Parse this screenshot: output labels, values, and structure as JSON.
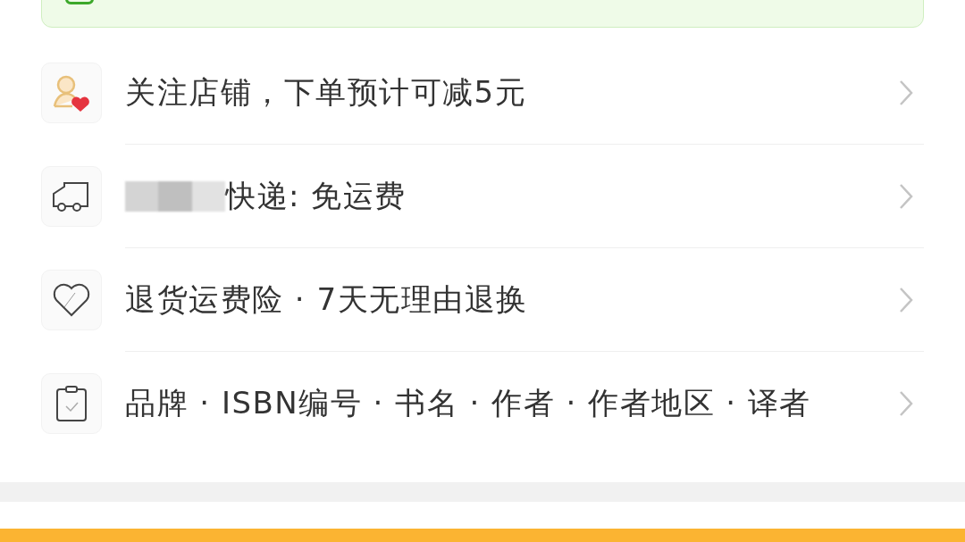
{
  "banner": {
    "kind": "notice"
  },
  "service_rows": [
    {
      "kind": "follow",
      "redacted": false,
      "label": "关注店铺，下单预计可减5元"
    },
    {
      "kind": "delivery",
      "redacted": true,
      "label": "快递: 免运费"
    },
    {
      "kind": "insurance",
      "redacted": false,
      "label": "退货运费险 · 7天无理由退换"
    },
    {
      "kind": "params",
      "redacted": false,
      "label": "品牌 · ISBN编号 · 书名 · 作者 · 作者地区 · 译者"
    }
  ]
}
